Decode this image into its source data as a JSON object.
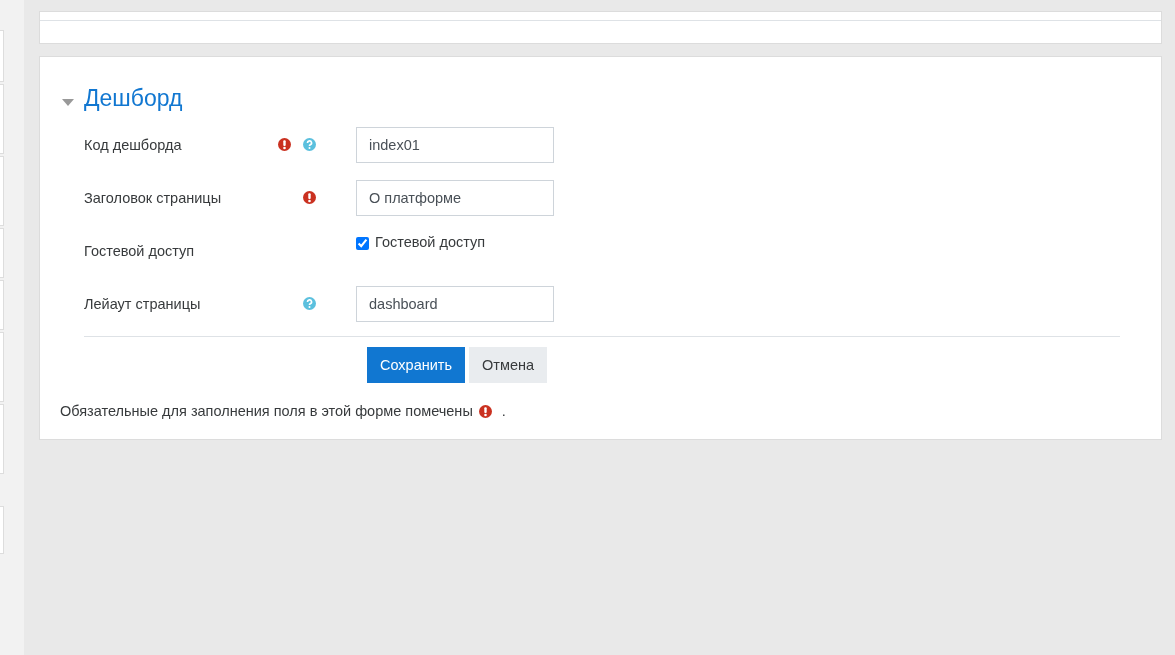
{
  "section": {
    "title": "Дешборд",
    "expanded": true
  },
  "fields": [
    {
      "kind": "text",
      "label": "Код дешборда",
      "required": true,
      "help": true,
      "value": "index01"
    },
    {
      "kind": "text",
      "label": "Заголовок страницы",
      "required": true,
      "help": false,
      "value": "О платформе"
    },
    {
      "kind": "checkbox",
      "label": "Гостевой доступ",
      "required": false,
      "help": false,
      "checked": true,
      "option": "Гостевой доступ"
    },
    {
      "kind": "text",
      "label": "Лейаут страницы",
      "required": false,
      "help": true,
      "value": "dashboard"
    }
  ],
  "buttons": [
    {
      "label": "Сохранить",
      "primary": true
    },
    {
      "label": "Отмена",
      "primary": false
    }
  ],
  "note": {
    "text": "Обязательные для заполнения поля в этой форме помечены",
    "end": "."
  }
}
